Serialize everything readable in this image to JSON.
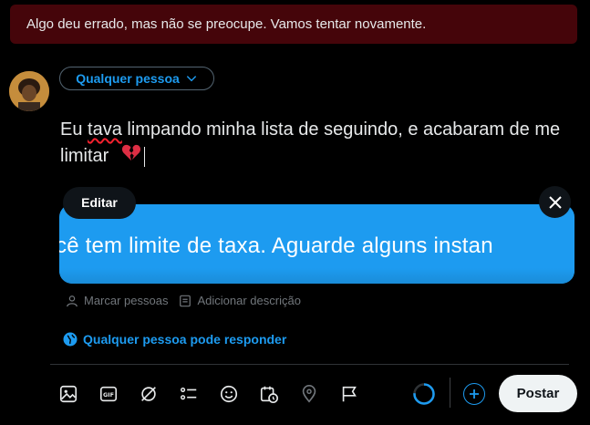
{
  "error": {
    "message": "Algo deu errado, mas não se preocupe. Vamos tentar novamente."
  },
  "composer": {
    "audience_label": "Qualquer pessoa",
    "text_part1": "Eu ",
    "text_misspelled": "tava",
    "text_part2": " limpando minha lista de seguindo, e acabaram de me limitar",
    "emoji": "broken-heart-icon"
  },
  "media": {
    "edit_label": "Editar",
    "image_text": "cê tem limite de taxa. Aguarde alguns instan"
  },
  "meta": {
    "tag_people": "Marcar pessoas",
    "add_description": "Adicionar descrição"
  },
  "reply_setting": {
    "label": "Qualquer pessoa pode responder"
  },
  "toolbar": {
    "post_label": "Postar",
    "accent": "#1d9bf0",
    "icons": [
      "image-icon",
      "gif-icon",
      "grok-icon",
      "poll-icon",
      "emoji-icon",
      "schedule-icon",
      "location-icon",
      "flag-icon"
    ]
  }
}
